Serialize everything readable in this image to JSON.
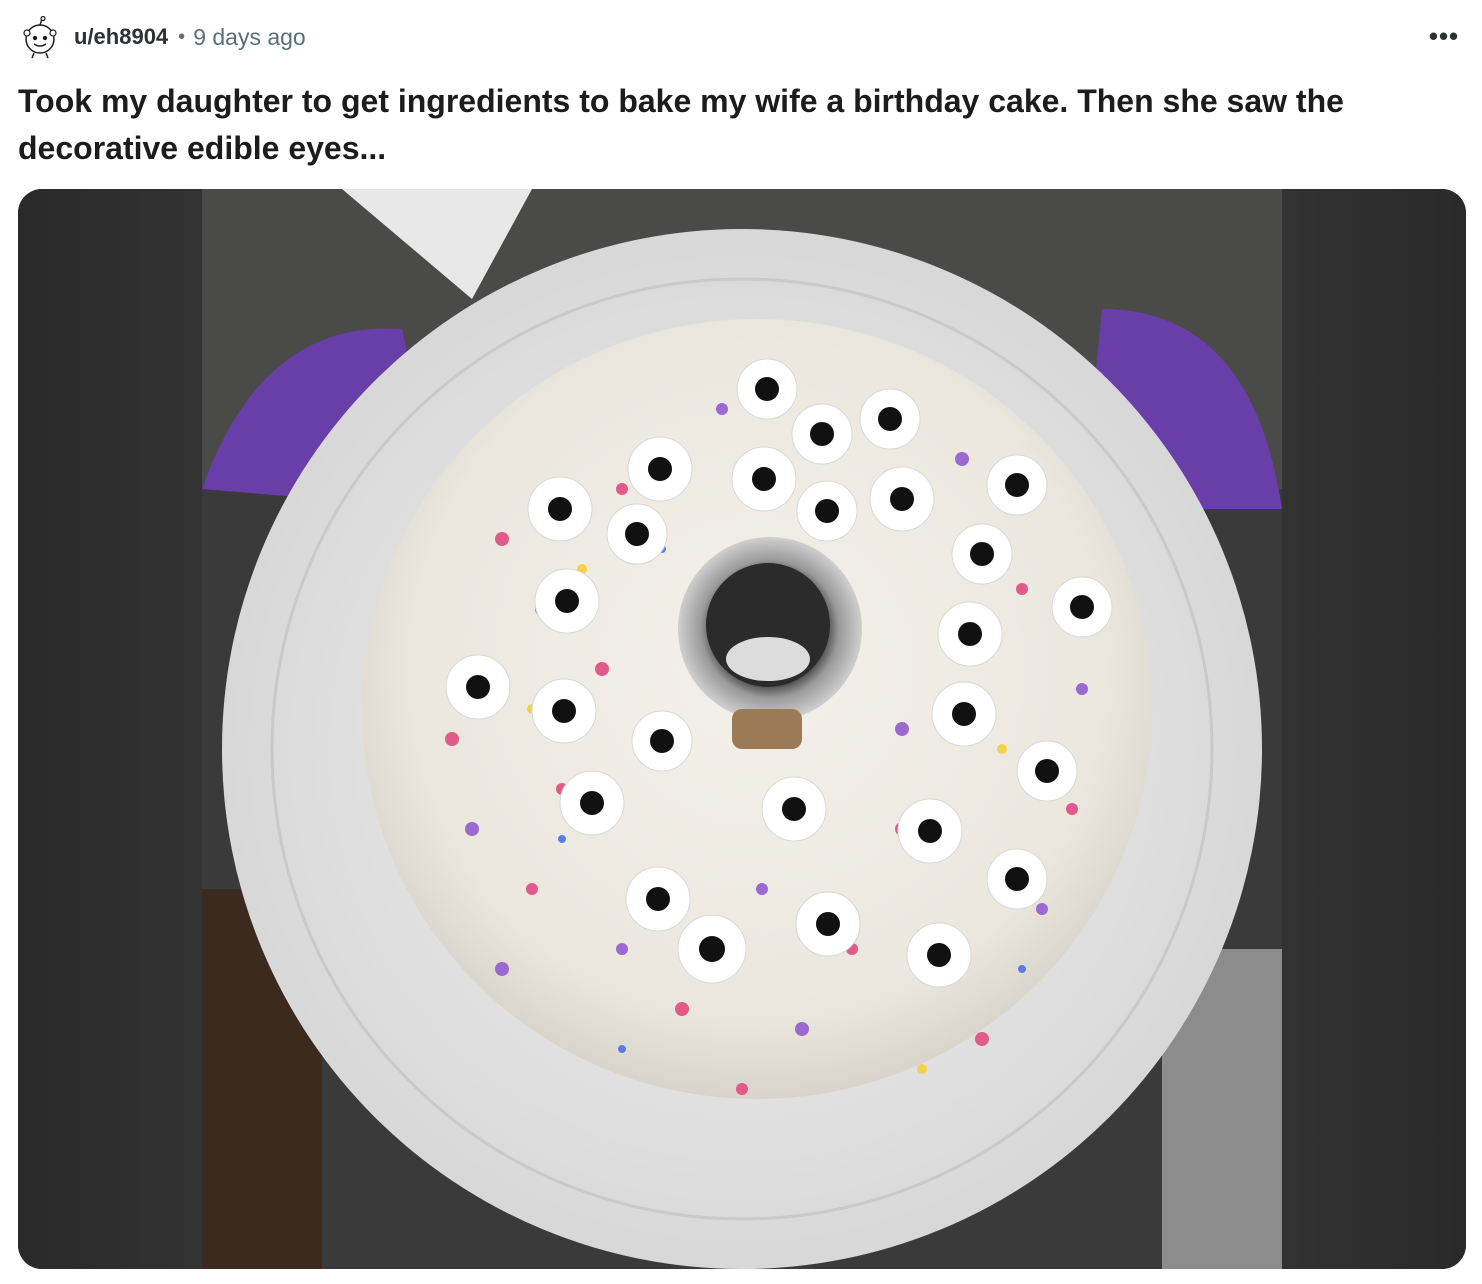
{
  "post": {
    "username": "u/eh8904",
    "separator": "•",
    "time_ago": "9 days ago",
    "overflow_icon": "more-horizontal-icon",
    "overflow_label": "•••",
    "title": "Took my daughter to get ingredients to bake my wife a birthday cake. Then she saw the decorative edible eyes...",
    "image_alt": ""
  },
  "colors": {
    "meta_text": "#576f76",
    "username_text": "#2a3236",
    "title_text": "#1c1c1c"
  }
}
